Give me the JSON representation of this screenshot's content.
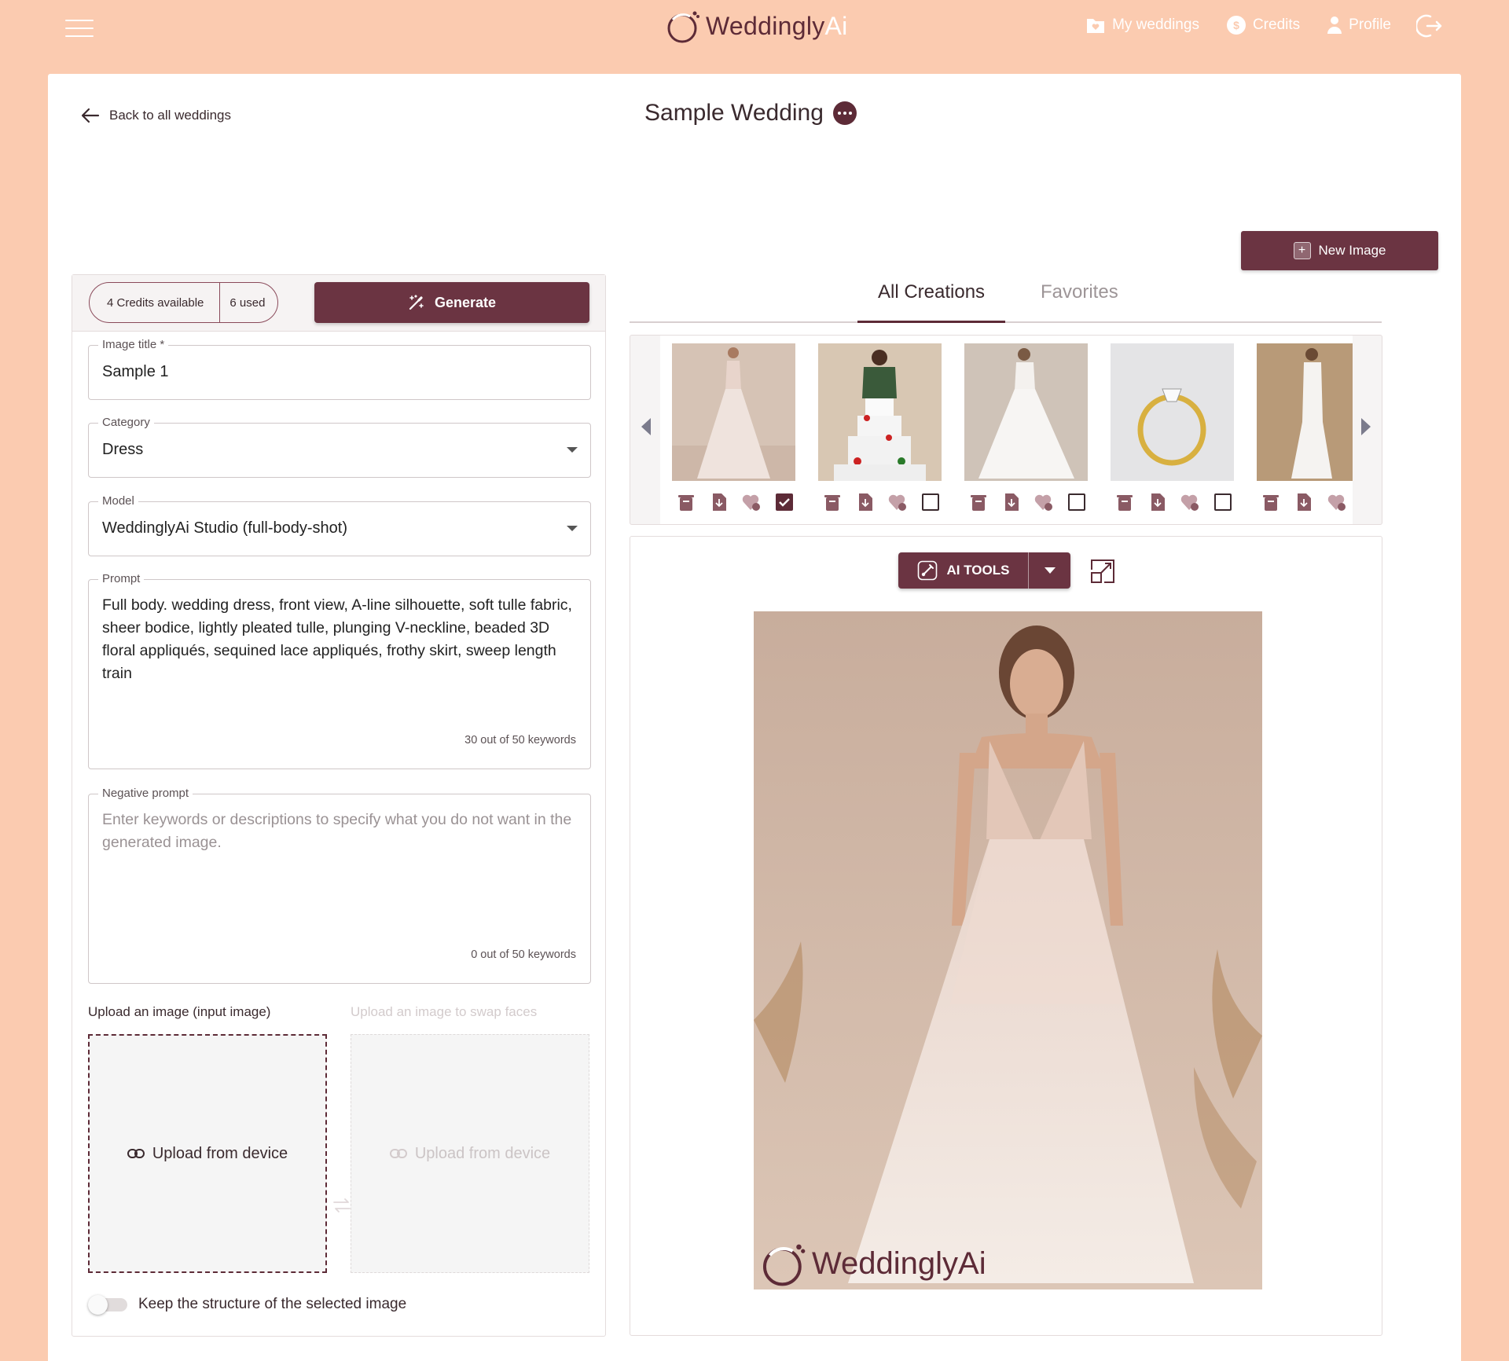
{
  "header": {
    "brand_main": "Weddingly",
    "brand_accent": "Ai",
    "nav": [
      {
        "label": "My weddings",
        "icon": "folder-heart-icon"
      },
      {
        "label": "Credits",
        "icon": "coin-icon"
      },
      {
        "label": "Profile",
        "icon": "user-icon"
      }
    ],
    "logout_icon": "logout-icon"
  },
  "page": {
    "back_label": "Back to all weddings",
    "title": "Sample Wedding",
    "new_image_label": "New Image"
  },
  "form": {
    "credits_available": "4 Credits available",
    "credits_used": "6 used",
    "generate_label": "Generate",
    "image_title": {
      "label": "Image title *",
      "value": "Sample 1"
    },
    "category": {
      "label": "Category",
      "value": "Dress"
    },
    "model": {
      "label": "Model",
      "value": "WeddinglyAi Studio (full-body-shot)"
    },
    "prompt": {
      "label": "Prompt",
      "value": "Full body. wedding dress, front view, A-line silhouette, soft tulle fabric, sheer bodice, lightly pleated tulle, plunging V-neckline, beaded 3D floral appliqués, sequined lace appliqués, frothy skirt, sweep length train",
      "counter": "30 out of 50 keywords"
    },
    "negative_prompt": {
      "label": "Negative prompt",
      "placeholder": "Enter keywords or descriptions to specify what you do not want in the generated image.",
      "counter": "0 out of 50 keywords"
    },
    "upload_input_label": "Upload an image (input image)",
    "upload_swap_label": "Upload an image to swap faces",
    "upload_button": "Upload from device",
    "keep_structure_label": "Keep the structure of the selected image",
    "keep_structure_on": false
  },
  "tabs": [
    {
      "label": "All Creations",
      "active": true
    },
    {
      "label": "Favorites",
      "active": false
    }
  ],
  "gallery": [
    {
      "subject": "wedding dress front",
      "selected": true
    },
    {
      "subject": "wedding cake",
      "selected": false
    },
    {
      "subject": "wedding dress back",
      "selected": false
    },
    {
      "subject": "engagement ring",
      "selected": false
    },
    {
      "subject": "mermaid wedding dress",
      "selected": false
    }
  ],
  "preview": {
    "ai_tools_label": "AI TOOLS",
    "watermark_text": "WeddinglyAi"
  },
  "colors": {
    "background": "#fbcbb0",
    "primary": "#6b3442",
    "brand": "#5d2b37"
  }
}
